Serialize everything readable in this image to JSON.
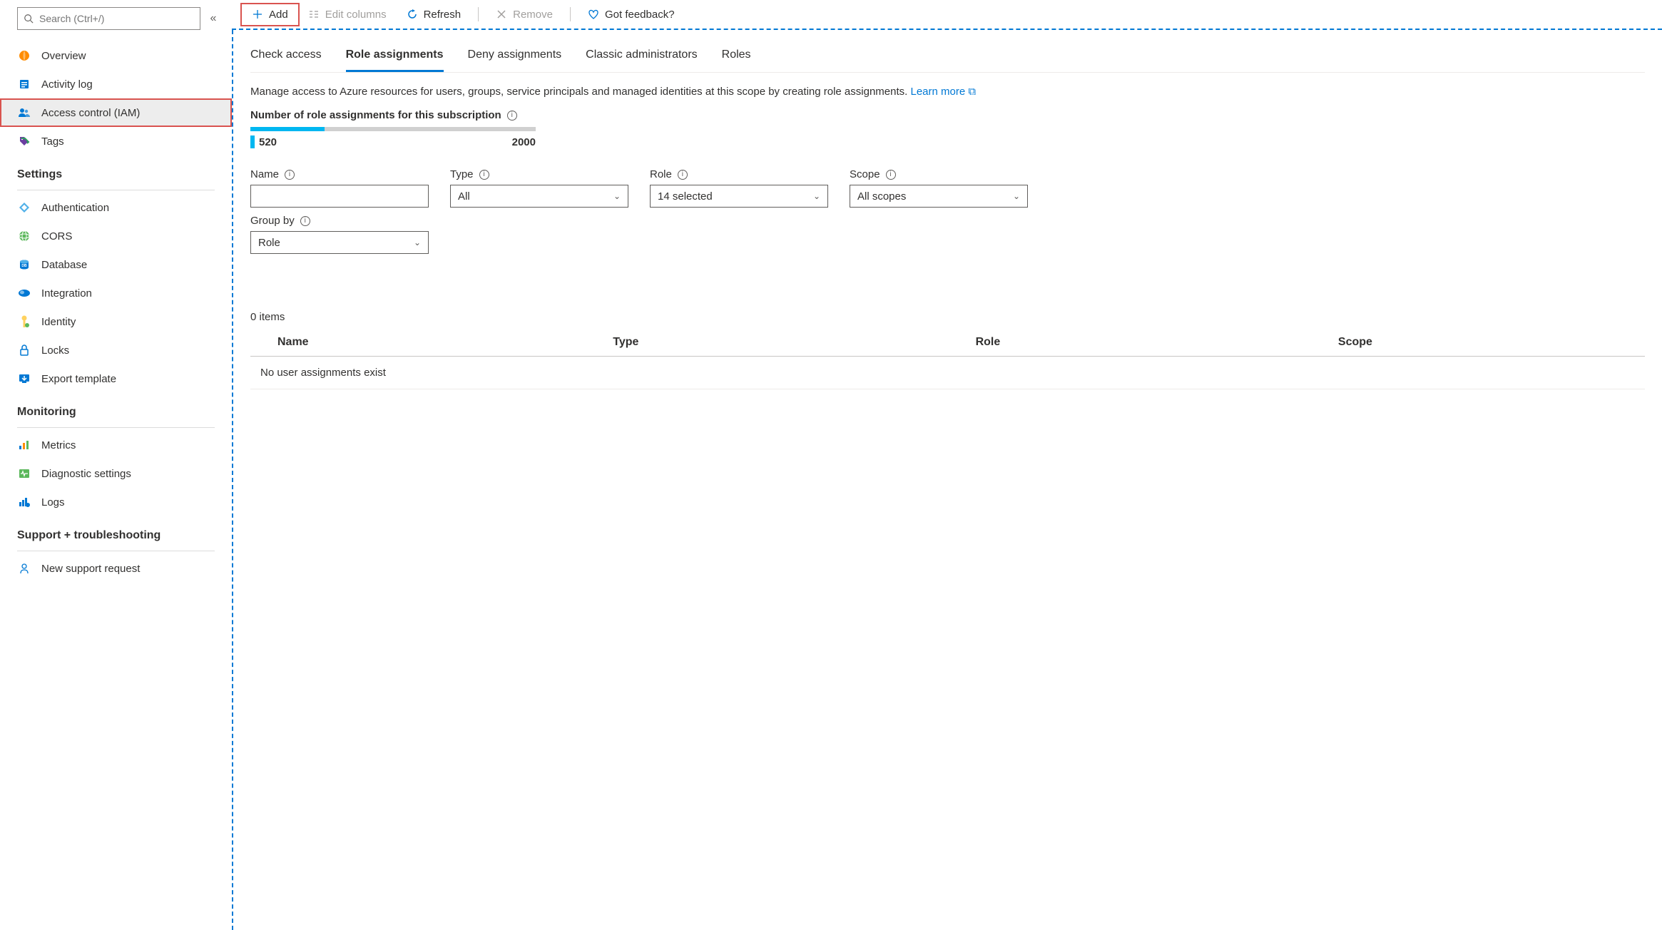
{
  "sidebar": {
    "search_placeholder": "Search (Ctrl+/)",
    "items": [
      {
        "label": "Overview",
        "icon": "overview"
      },
      {
        "label": "Activity log",
        "icon": "activitylog"
      },
      {
        "label": "Access control (IAM)",
        "icon": "people",
        "selected": true,
        "highlight": true
      },
      {
        "label": "Tags",
        "icon": "tags"
      }
    ],
    "sections": [
      {
        "title": "Settings",
        "items": [
          {
            "label": "Authentication",
            "icon": "auth"
          },
          {
            "label": "CORS",
            "icon": "cors"
          },
          {
            "label": "Database",
            "icon": "database"
          },
          {
            "label": "Integration",
            "icon": "integration"
          },
          {
            "label": "Identity",
            "icon": "identity"
          },
          {
            "label": "Locks",
            "icon": "locks"
          },
          {
            "label": "Export template",
            "icon": "export"
          }
        ]
      },
      {
        "title": "Monitoring",
        "items": [
          {
            "label": "Metrics",
            "icon": "metrics"
          },
          {
            "label": "Diagnostic settings",
            "icon": "diag"
          },
          {
            "label": "Logs",
            "icon": "logs"
          }
        ]
      },
      {
        "title": "Support + troubleshooting",
        "items": [
          {
            "label": "New support request",
            "icon": "support"
          }
        ]
      }
    ]
  },
  "toolbar": {
    "add": "Add",
    "edit_columns": "Edit columns",
    "refresh": "Refresh",
    "remove": "Remove",
    "feedback": "Got feedback?"
  },
  "tabs": [
    "Check access",
    "Role assignments",
    "Deny assignments",
    "Classic administrators",
    "Roles"
  ],
  "active_tab": 1,
  "description_text": "Manage access to Azure resources for users, groups, service principals and managed identities at this scope by creating role assignments. ",
  "learn_more": "Learn more",
  "external_icon": "↗",
  "count_heading": "Number of role assignments for this subscription",
  "count_current": "520",
  "count_max": "2000",
  "filters": {
    "name_label": "Name",
    "type_label": "Type",
    "type_value": "All",
    "role_label": "Role",
    "role_value": "14 selected",
    "scope_label": "Scope",
    "scope_value": "All scopes",
    "groupby_label": "Group by",
    "groupby_value": "Role"
  },
  "items_count": "0 items",
  "table_headers": {
    "name": "Name",
    "type": "Type",
    "role": "Role",
    "scope": "Scope"
  },
  "empty_text": "No user assignments exist"
}
